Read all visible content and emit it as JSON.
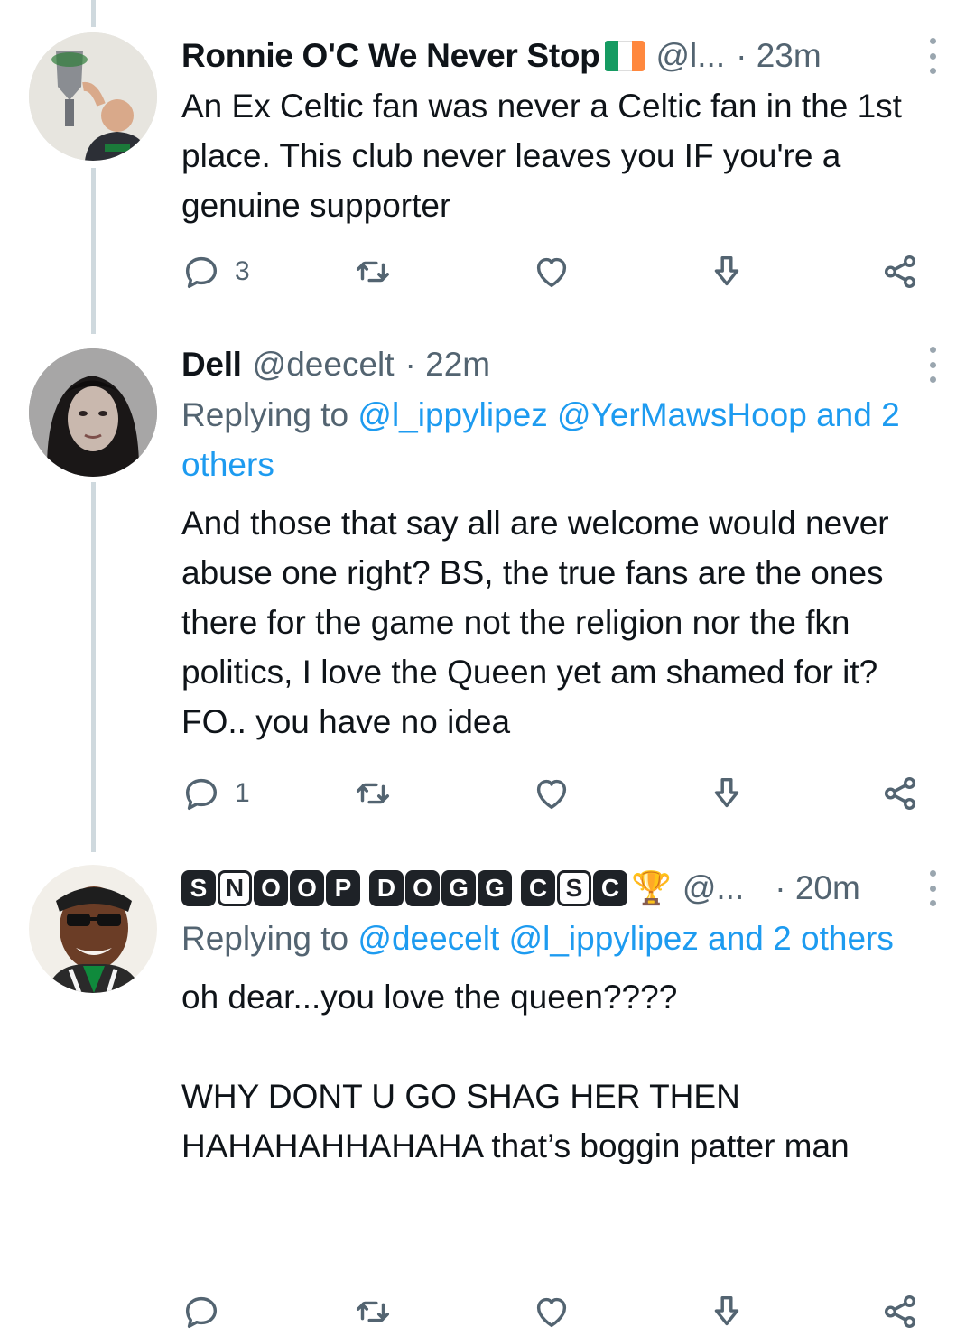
{
  "tweets": [
    {
      "display_name": "Ronnie O'C We Never Stop",
      "handle": "@l...",
      "time": "· 23m",
      "avatar_icon": "avatar-man-with-trophy",
      "flag_colors": [
        "#169b62",
        "#ffffff",
        "#ff883e"
      ],
      "text": "An Ex Celtic fan was never a Celtic fan in the 1st place. This club never leaves you IF you're a genuine supporter",
      "replies": "3"
    },
    {
      "display_name": "Dell",
      "handle": "@deecelt",
      "time": "· 22m",
      "avatar_icon": "avatar-woman",
      "replying_prefix": "Replying to",
      "replying_links": "@l_ippylipez @YerMawsHoop and 2 others",
      "text": "And those that say all are welcome would never abuse one right? BS, the true fans are the ones there for the game not the religion nor the fkn politics, I love the Queen yet am shamed for it? FO.. you have no idea",
      "replies": "1"
    },
    {
      "display_name_letters": [
        "S",
        "N",
        "O",
        "O",
        "P",
        "D",
        "O",
        "G",
        "G",
        "C",
        "S",
        "C"
      ],
      "handle": "@...",
      "time": "· 20m",
      "avatar_icon": "avatar-man-sunglasses",
      "badge_icon": "trophy-emoji",
      "badge_glyph": "🏆",
      "replying_prefix": "Replying to",
      "replying_links": "@deecelt @l_ippylipez and 2 others",
      "text": "oh dear...you love the queen????\n\nWHY DONT U GO SHAG HER THEN HAHAHAHHAHAHA that’s boggin patter man",
      "replies": ""
    }
  ],
  "colors": {
    "text": "#0f1419",
    "secondary": "#536471",
    "link": "#1d9bf0",
    "thread_line": "#cfd9de"
  }
}
